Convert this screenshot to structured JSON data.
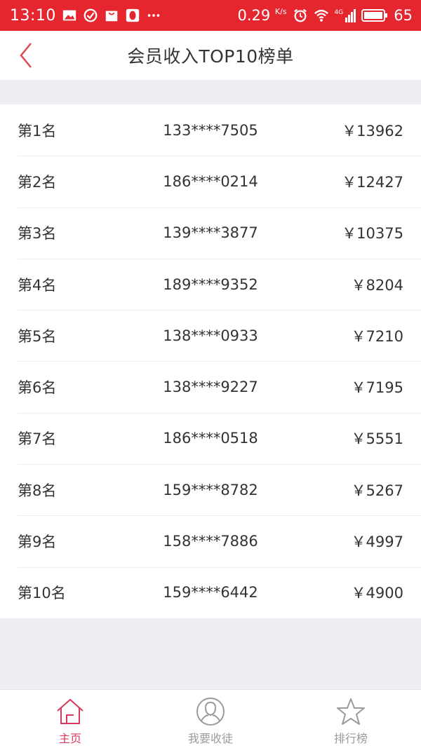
{
  "status_bar": {
    "time": "13:10",
    "speed": "0.29",
    "speed_unit": "K/s",
    "network": "4G",
    "battery": "65"
  },
  "header": {
    "title": "会员收入TOP10榜单"
  },
  "ranking": [
    {
      "rank": "第1名",
      "phone": "133****7505",
      "amount": "￥13962"
    },
    {
      "rank": "第2名",
      "phone": "186****0214",
      "amount": "￥12427"
    },
    {
      "rank": "第3名",
      "phone": "139****3877",
      "amount": "￥10375"
    },
    {
      "rank": "第4名",
      "phone": "189****9352",
      "amount": "￥8204"
    },
    {
      "rank": "第5名",
      "phone": "138****0933",
      "amount": "￥7210"
    },
    {
      "rank": "第6名",
      "phone": "138****9227",
      "amount": "￥7195"
    },
    {
      "rank": "第7名",
      "phone": "186****0518",
      "amount": "￥5551"
    },
    {
      "rank": "第8名",
      "phone": "159****8782",
      "amount": "￥5267"
    },
    {
      "rank": "第9名",
      "phone": "158****7886",
      "amount": "￥4997"
    },
    {
      "rank": "第10名",
      "phone": "159****6442",
      "amount": "￥4900"
    }
  ],
  "tabs": [
    {
      "label": "主页",
      "icon": "home-icon",
      "active": true
    },
    {
      "label": "我要收徒",
      "icon": "user-icon",
      "active": false
    },
    {
      "label": "排行榜",
      "icon": "star-icon",
      "active": false
    }
  ],
  "colors": {
    "status_bar": "#e6262f",
    "accent": "#d6395b",
    "background": "#eeeef3"
  }
}
